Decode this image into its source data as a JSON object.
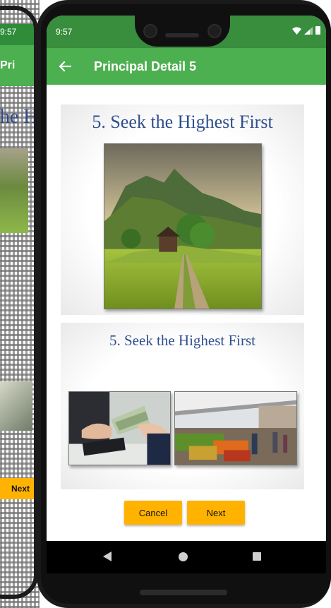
{
  "ghost": {
    "time": "9:57",
    "title": "Pri",
    "heading": "he H",
    "next_label": "Next"
  },
  "status_bar": {
    "time": "9:57",
    "icons": [
      "wifi-icon",
      "signal-icon",
      "battery-icon"
    ]
  },
  "app_bar": {
    "title": "Principal Detail 5",
    "back_icon": "arrow-left-icon"
  },
  "slides": [
    {
      "title": "5. Seek the Highest First",
      "image": "mountain-landscape-with-path"
    },
    {
      "title": "5. Seek the Highest First",
      "images": [
        "money-handover-photo",
        "market-stalls-photo"
      ]
    }
  ],
  "buttons": {
    "cancel_label": "Cancel",
    "next_label": "Next"
  },
  "nav_bar": {
    "icons": [
      "back-triangle-icon",
      "home-circle-icon",
      "recents-square-icon"
    ]
  },
  "colors": {
    "status_bar": "#388e3c",
    "app_bar": "#4caf50",
    "button": "#ffb300",
    "slide_title": "#2f4f8f"
  }
}
